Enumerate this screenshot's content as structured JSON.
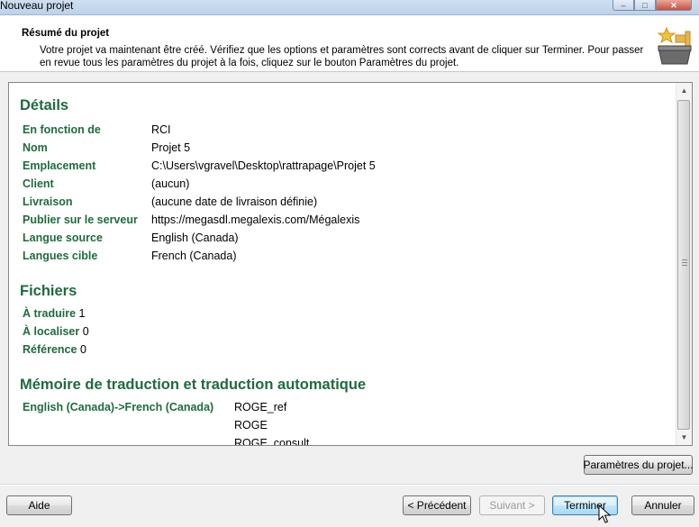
{
  "window": {
    "title": "Nouveau projet",
    "minimize": "–",
    "maximize": "□",
    "close": "✕"
  },
  "header": {
    "title": "Résumé du projet",
    "description": "Votre projet va maintenant être créé. Vérifiez que les options et paramètres sont corrects avant de cliquer sur Terminer. Pour passer en revue tous les paramètres du projet à la fois, cliquez sur le bouton Paramètres du projet.",
    "icon": "wizard-finish-icon"
  },
  "summary": {
    "details": {
      "title": "Détails",
      "rows": [
        {
          "label": "En fonction de",
          "value": "RCI"
        },
        {
          "label": "Nom",
          "value": "Projet 5"
        },
        {
          "label": "Emplacement",
          "value": "C:\\Users\\vgravel\\Desktop\\rattrapage\\Projet 5"
        },
        {
          "label": "Client",
          "value": "(aucun)"
        },
        {
          "label": "Livraison",
          "value": "(aucune date de livraison définie)"
        },
        {
          "label": "Publier sur le serveur",
          "value": "https://megasdl.megalexis.com/Mégalexis"
        },
        {
          "label": "Langue source",
          "value": "English (Canada)"
        },
        {
          "label": "Langues cible",
          "value": "French (Canada)"
        }
      ]
    },
    "files": {
      "title": "Fichiers",
      "rows": [
        {
          "label": "À traduire",
          "value": "1"
        },
        {
          "label": "À localiser",
          "value": "0"
        },
        {
          "label": "Référence",
          "value": "0"
        }
      ]
    },
    "tm": {
      "title": "Mémoire de traduction et traduction automatique",
      "pair": "English (Canada)->French (Canada)",
      "items": [
        "ROGE_ref",
        "ROGE",
        "ROGE_consult"
      ]
    }
  },
  "buttons": {
    "project_settings": "Paramètres du projet...",
    "help": "Aide",
    "previous": "< Précédent",
    "next": "Suivant >",
    "finish": "Terminer",
    "cancel": "Annuler"
  },
  "colors": {
    "section_green": "#1f6b3e",
    "focus_blue": "#3c7fb1"
  }
}
